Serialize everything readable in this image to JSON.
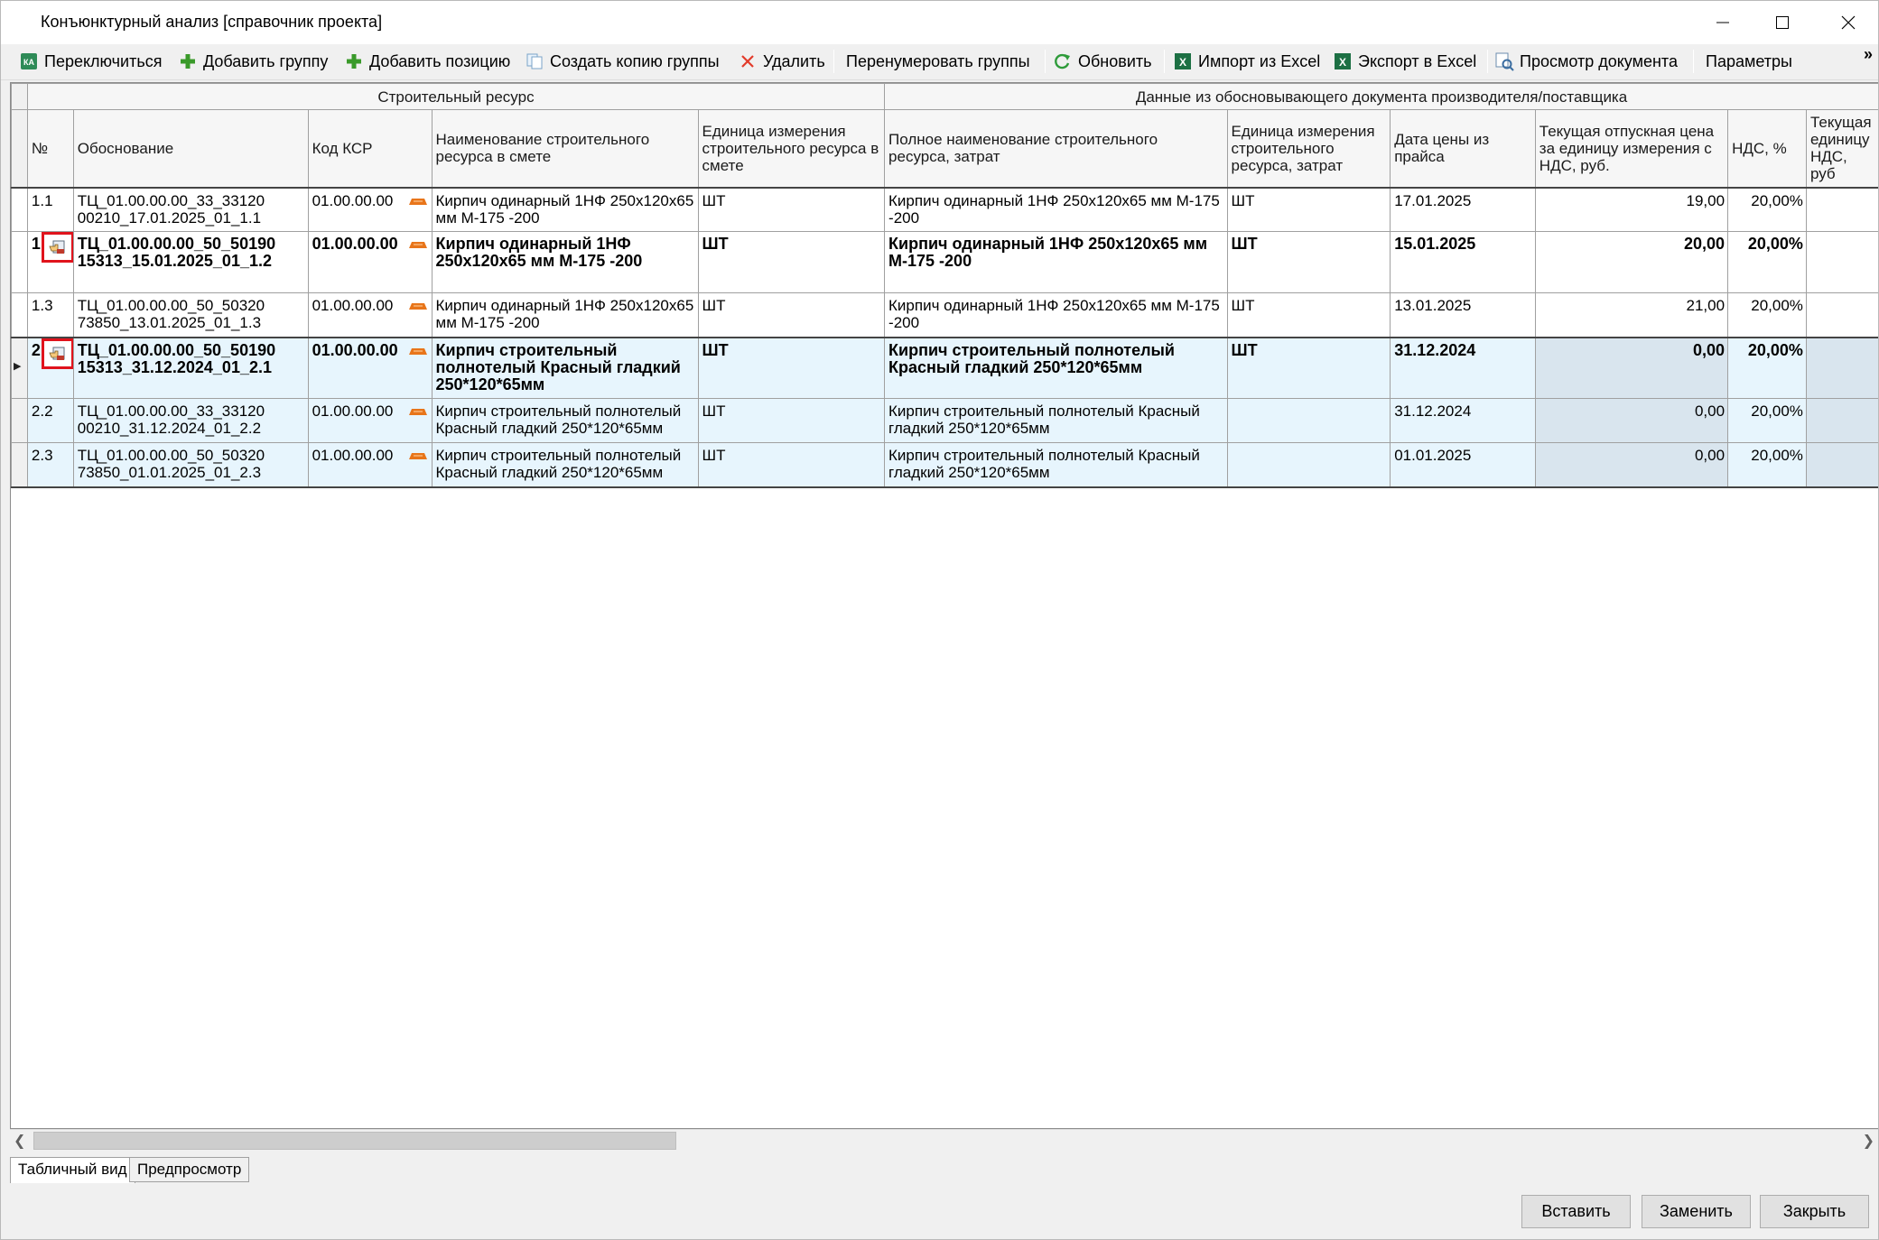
{
  "window": {
    "title": "Конъюнктурный анализ [справочник проекта]"
  },
  "toolbar": {
    "items": [
      {
        "label": "Переключиться",
        "icon": "switch-ka-icon"
      },
      {
        "label": "Добавить группу",
        "icon": "plus-icon"
      },
      {
        "label": "Добавить позицию",
        "icon": "plus-icon"
      },
      {
        "label": "Создать копию группы",
        "icon": "copy-icon"
      },
      {
        "label": "Удалить",
        "icon": "delete-x-icon"
      },
      {
        "label": "Перенумеровать группы",
        "icon": ""
      },
      {
        "label": "Обновить",
        "icon": "refresh-icon"
      },
      {
        "label": "Импорт из Excel",
        "icon": "excel-icon"
      },
      {
        "label": "Экспорт в Excel",
        "icon": "excel-icon"
      },
      {
        "label": "Просмотр документа",
        "icon": "document-view-icon"
      },
      {
        "label": "Параметры",
        "icon": ""
      }
    ],
    "overflow": "»"
  },
  "grid": {
    "group_headers": {
      "resource": "Строительный ресурс",
      "source": "Данные из обосновывающего документа производителя/поставщика"
    },
    "columns": [
      "№",
      "Обоснование",
      "Код КСР",
      "Наименование строительного ресурса в смете",
      "Единица измерения строительного ресурса в смете",
      "Полное наименование строительного ресурса, затрат",
      "Единица измерения строительного ресурса, затрат",
      "Дата цены из прайса",
      "Текущая отпускная цена за единицу измерения с НДС, руб.",
      "НДС, %",
      "Текущая единицу НДС, руб"
    ],
    "rows": [
      {
        "num": "1.1",
        "basis": "ТЦ_01.00.00.00_33_33120 00210_17.01.2025_01_1.1",
        "ksr": "01.00.00.00",
        "name": "Кирпич одинарный 1НФ 250х120х65 мм М-175 -200",
        "unit": "ШТ",
        "full_name": "Кирпич одинарный 1НФ 250х120х65 мм М-175 -200",
        "unit2": "ШТ",
        "date": "17.01.2025",
        "price": "19,00",
        "vat": "20,00%"
      },
      {
        "num": "1.",
        "basis": "ТЦ_01.00.00.00_50_50190 15313_15.01.2025_01_1.2",
        "ksr": "01.00.00.00",
        "name": "Кирпич одинарный 1НФ 250х120х65 мм М-175 -200",
        "unit": "ШТ",
        "full_name": "Кирпич одинарный 1НФ 250х120х65 мм М-175 -200",
        "unit2": "ШТ",
        "date": "15.01.2025",
        "price": "20,00",
        "vat": "20,00%"
      },
      {
        "num": "1.3",
        "basis": "ТЦ_01.00.00.00_50_50320 73850_13.01.2025_01_1.3",
        "ksr": "01.00.00.00",
        "name": "Кирпич одинарный 1НФ 250х120х65 мм М-175 -200",
        "unit": "ШТ",
        "full_name": "Кирпич одинарный 1НФ 250х120х65 мм М-175 -200",
        "unit2": "ШТ",
        "date": "13.01.2025",
        "price": "21,00",
        "vat": "20,00%"
      },
      {
        "num": "2.",
        "basis": "ТЦ_01.00.00.00_50_50190 15313_31.12.2024_01_2.1",
        "ksr": "01.00.00.00",
        "name": "Кирпич строительный полнотелый Красный гладкий 250*120*65мм",
        "unit": "ШТ",
        "full_name": "Кирпич строительный полнотелый Красный гладкий 250*120*65мм",
        "unit2": "ШТ",
        "date": "31.12.2024",
        "price": "0,00",
        "vat": "20,00%"
      },
      {
        "num": "2.2",
        "basis": "ТЦ_01.00.00.00_33_33120 00210_31.12.2024_01_2.2",
        "ksr": "01.00.00.00",
        "name": "Кирпич строительный полнотелый Красный гладкий 250*120*65мм",
        "unit": "ШТ",
        "full_name": "Кирпич строительный полнотелый Красный гладкий 250*120*65мм",
        "unit2": "",
        "date": "31.12.2024",
        "price": "0,00",
        "vat": "20,00%"
      },
      {
        "num": "2.3",
        "basis": "ТЦ_01.00.00.00_50_50320 73850_01.01.2025_01_2.3",
        "ksr": "01.00.00.00",
        "name": "Кирпич строительный полнотелый Красный гладкий 250*120*65мм",
        "unit": "ШТ",
        "full_name": "Кирпич строительный полнотелый Красный гладкий 250*120*65мм",
        "unit2": "",
        "date": "01.01.2025",
        "price": "0,00",
        "vat": "20,00%"
      }
    ]
  },
  "tabs": [
    {
      "label": "Табличный вид",
      "active": true
    },
    {
      "label": "Предпросмотр",
      "active": false
    }
  ],
  "buttons": {
    "insert": "Вставить",
    "replace": "Заменить",
    "close": "Закрыть"
  },
  "colors": {
    "selected_group_bg": "#e7f5fd",
    "price_col_bg": "#d9e5ee",
    "marker_red": "#e0131c",
    "excel_green": "#1d7044"
  }
}
